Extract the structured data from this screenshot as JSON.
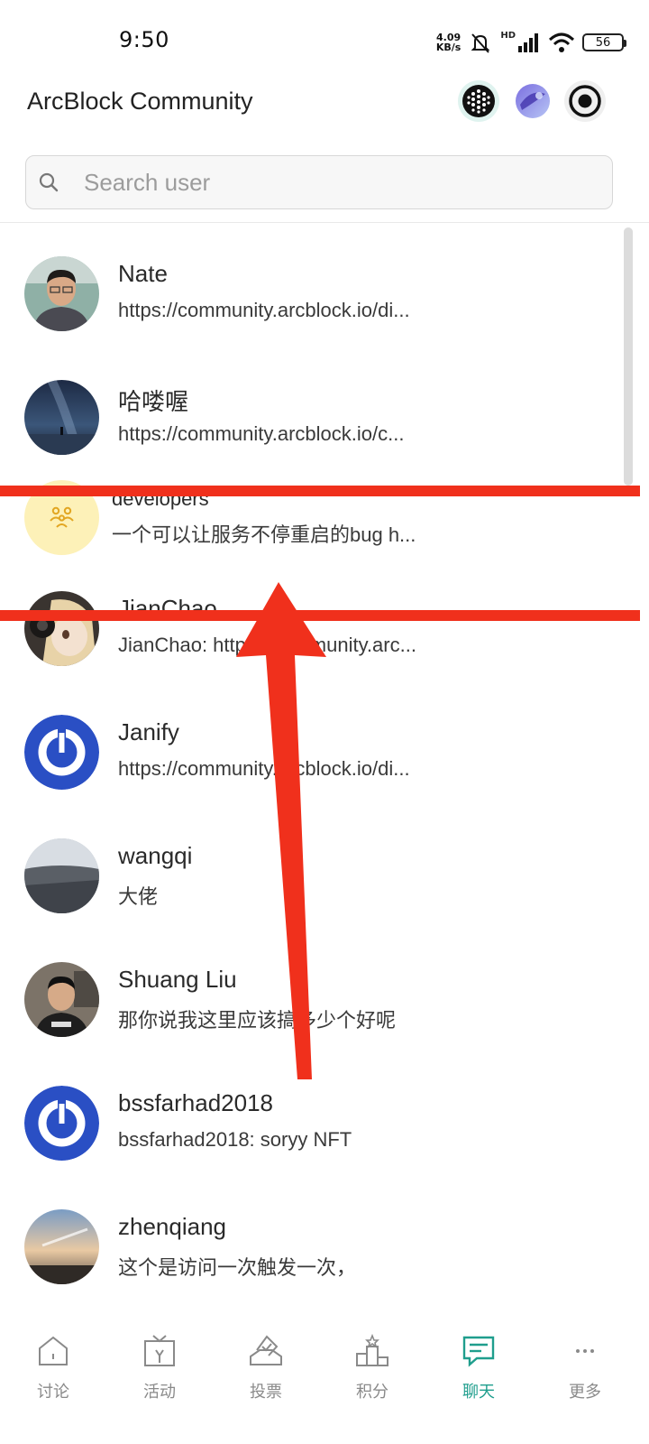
{
  "status_bar": {
    "time": "9:50",
    "net_speed_value": "4.09",
    "net_speed_unit": "KB/s",
    "hd_label": "HD",
    "battery": "56"
  },
  "header": {
    "title": "ArcBlock Community"
  },
  "search": {
    "placeholder": "Search user"
  },
  "chats": [
    {
      "name": "Nate",
      "preview": "https://community.arcblock.io/di..."
    },
    {
      "name": "哈喽喔",
      "preview": "https://community.arcblock.io/c..."
    },
    {
      "name": "developers",
      "preview": "一个可以让服务不停重启的bug h..."
    },
    {
      "name": "JianChao",
      "preview": "JianChao: https://community.arc..."
    },
    {
      "name": "Janify",
      "preview": "https://community.arcblock.io/di..."
    },
    {
      "name": "wangqi",
      "preview": "大佬"
    },
    {
      "name": "Shuang Liu",
      "preview": "那你说我这里应该搞多少个好呢"
    },
    {
      "name": "bssfarhad2018",
      "preview": "bssfarhad2018: soryy NFT"
    },
    {
      "name": "zhenqiang",
      "preview": "这个是访问一次触发一次，"
    }
  ],
  "bottom_nav": [
    {
      "label": "讨论",
      "icon": "home-icon"
    },
    {
      "label": "活动",
      "icon": "gift-icon"
    },
    {
      "label": "投票",
      "icon": "vote-icon"
    },
    {
      "label": "积分",
      "icon": "podium-icon"
    },
    {
      "label": "聊天",
      "icon": "chat-icon",
      "active": true
    },
    {
      "label": "更多",
      "icon": "more-icon"
    }
  ],
  "colors": {
    "accent": "#1f9e8d",
    "annotation": "#f0301c",
    "group_avatar_bg": "#fdf1b8",
    "blue_avatar": "#2a4fc4"
  }
}
